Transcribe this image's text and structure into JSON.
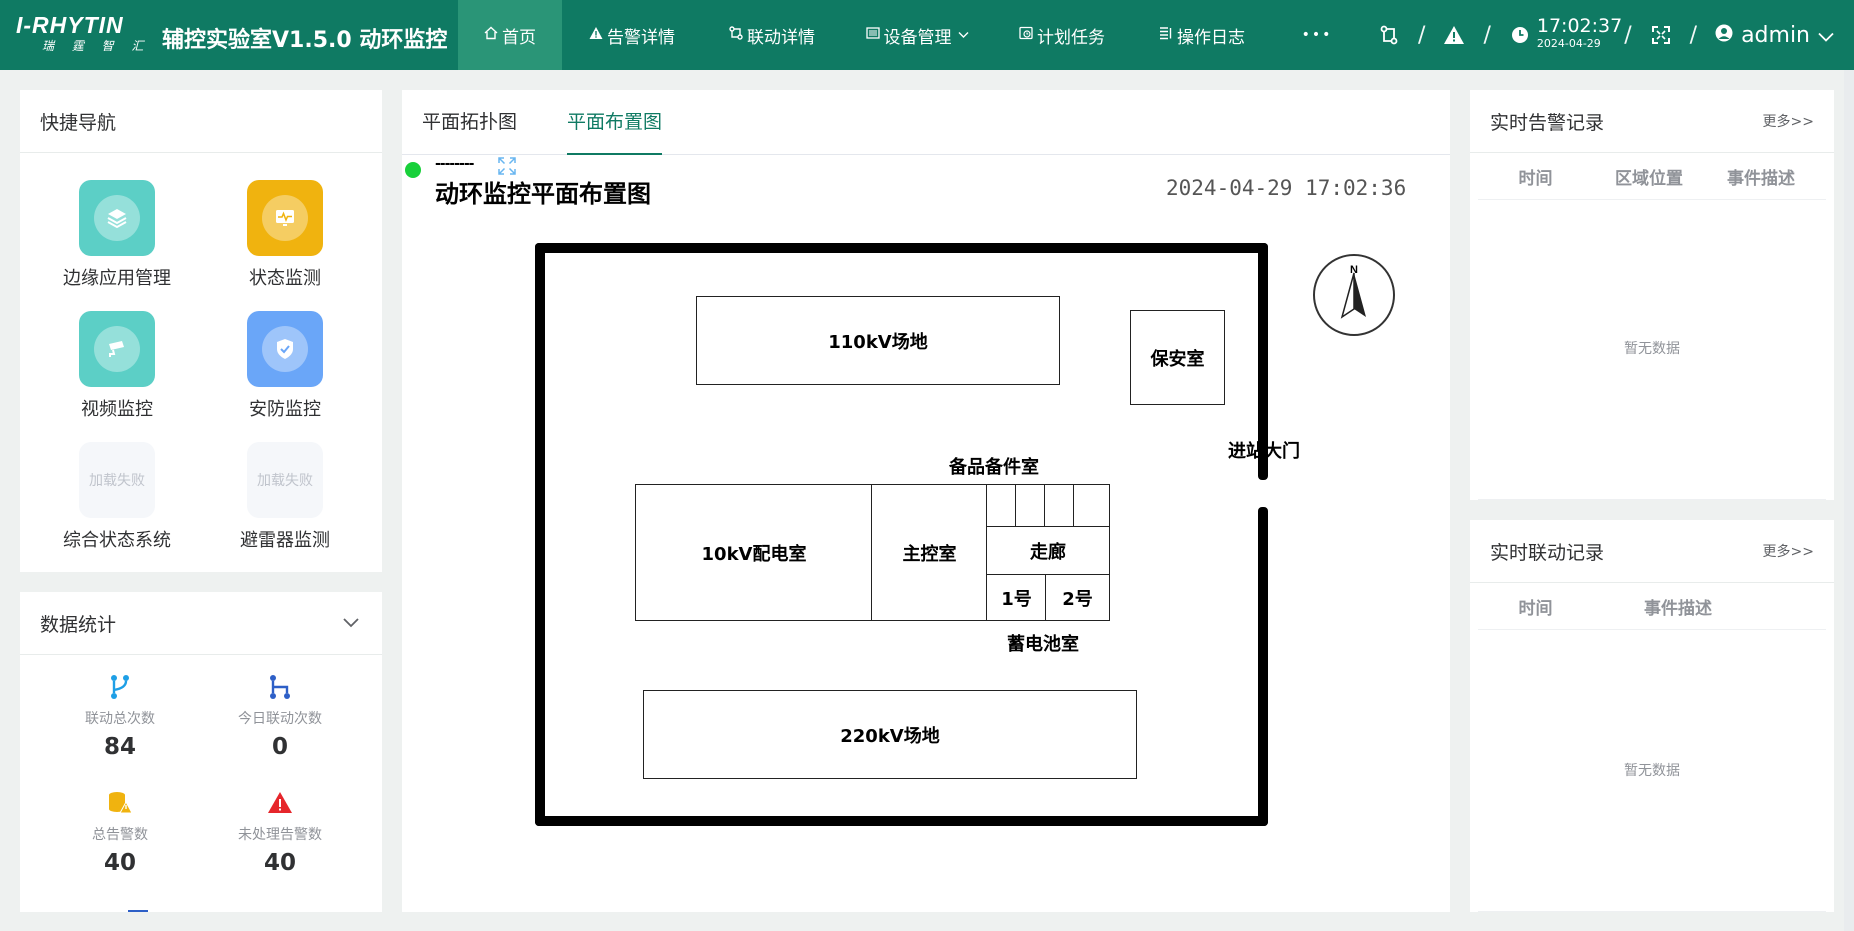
{
  "header": {
    "logo_main": "I-RHYTIN",
    "logo_sub": "瑞 霆 智 汇",
    "app_title": "辅控实验室V1.5.0  动环监控",
    "nav": [
      {
        "label": "首页",
        "icon": "home-icon"
      },
      {
        "label": "告警详情",
        "icon": "warning-icon"
      },
      {
        "label": "联动详情",
        "icon": "link-icon"
      },
      {
        "label": "设备管理",
        "icon": "device-icon"
      },
      {
        "label": "计划任务",
        "icon": "schedule-icon"
      },
      {
        "label": "操作日志",
        "icon": "log-icon"
      },
      {
        "label": "•••",
        "icon": "more-icon"
      }
    ],
    "time": "17:02:37",
    "date": "2024-04-29",
    "user": "admin"
  },
  "quick_nav": {
    "title": "快捷导航",
    "items": [
      {
        "label": "边缘应用管理",
        "icon": "layers-icon",
        "color": "#5ccfc6"
      },
      {
        "label": "状态监测",
        "icon": "monitor-icon",
        "color": "#f0b30f"
      },
      {
        "label": "视频监控",
        "icon": "camera-icon",
        "color": "#5ccfc6"
      },
      {
        "label": "安防监控",
        "icon": "shield-icon",
        "color": "#6aa6f8"
      },
      {
        "label": "综合状态系统",
        "fail_text": "加载失败"
      },
      {
        "label": "避雷器监测",
        "fail_text": "加载失败"
      }
    ]
  },
  "stats": {
    "title": "数据统计",
    "items": [
      {
        "label": "联动总次数",
        "value": "84",
        "icon": "branch-icon",
        "color": "#1e9fe6"
      },
      {
        "label": "今日联动次数",
        "value": "0",
        "icon": "merge-icon",
        "color": "#2d5fc7"
      },
      {
        "label": "总告警数",
        "value": "40",
        "icon": "database-warning-icon",
        "color": "#f0b30f"
      },
      {
        "label": "未处理告警数",
        "value": "40",
        "icon": "alert-triangle-icon",
        "color": "#e6262b"
      }
    ]
  },
  "center": {
    "tabs": [
      "平面拓扑图",
      "平面布置图"
    ],
    "dash": "--------",
    "plan_title": "动环监控平面布置图",
    "plan_time": "2024-04-29  17:02:36",
    "compass": "N",
    "rooms": {
      "r110": "110kV场地",
      "guard": "保安室",
      "gate": "进站大门",
      "spare": "备品备件室",
      "r10": "10kV配电室",
      "main": "主控室",
      "corridor": "走廊",
      "no1": "1号",
      "no2": "2号",
      "battery": "蓄电池室",
      "r220": "220kV场地"
    }
  },
  "alarm_panel": {
    "title": "实时告警记录",
    "more": "更多>>",
    "columns": [
      "时间",
      "区域位置",
      "事件描述"
    ],
    "empty": "暂无数据"
  },
  "linkage_panel": {
    "title": "实时联动记录",
    "more": "更多>>",
    "columns": [
      "时间",
      "事件描述"
    ],
    "empty": "暂无数据"
  }
}
